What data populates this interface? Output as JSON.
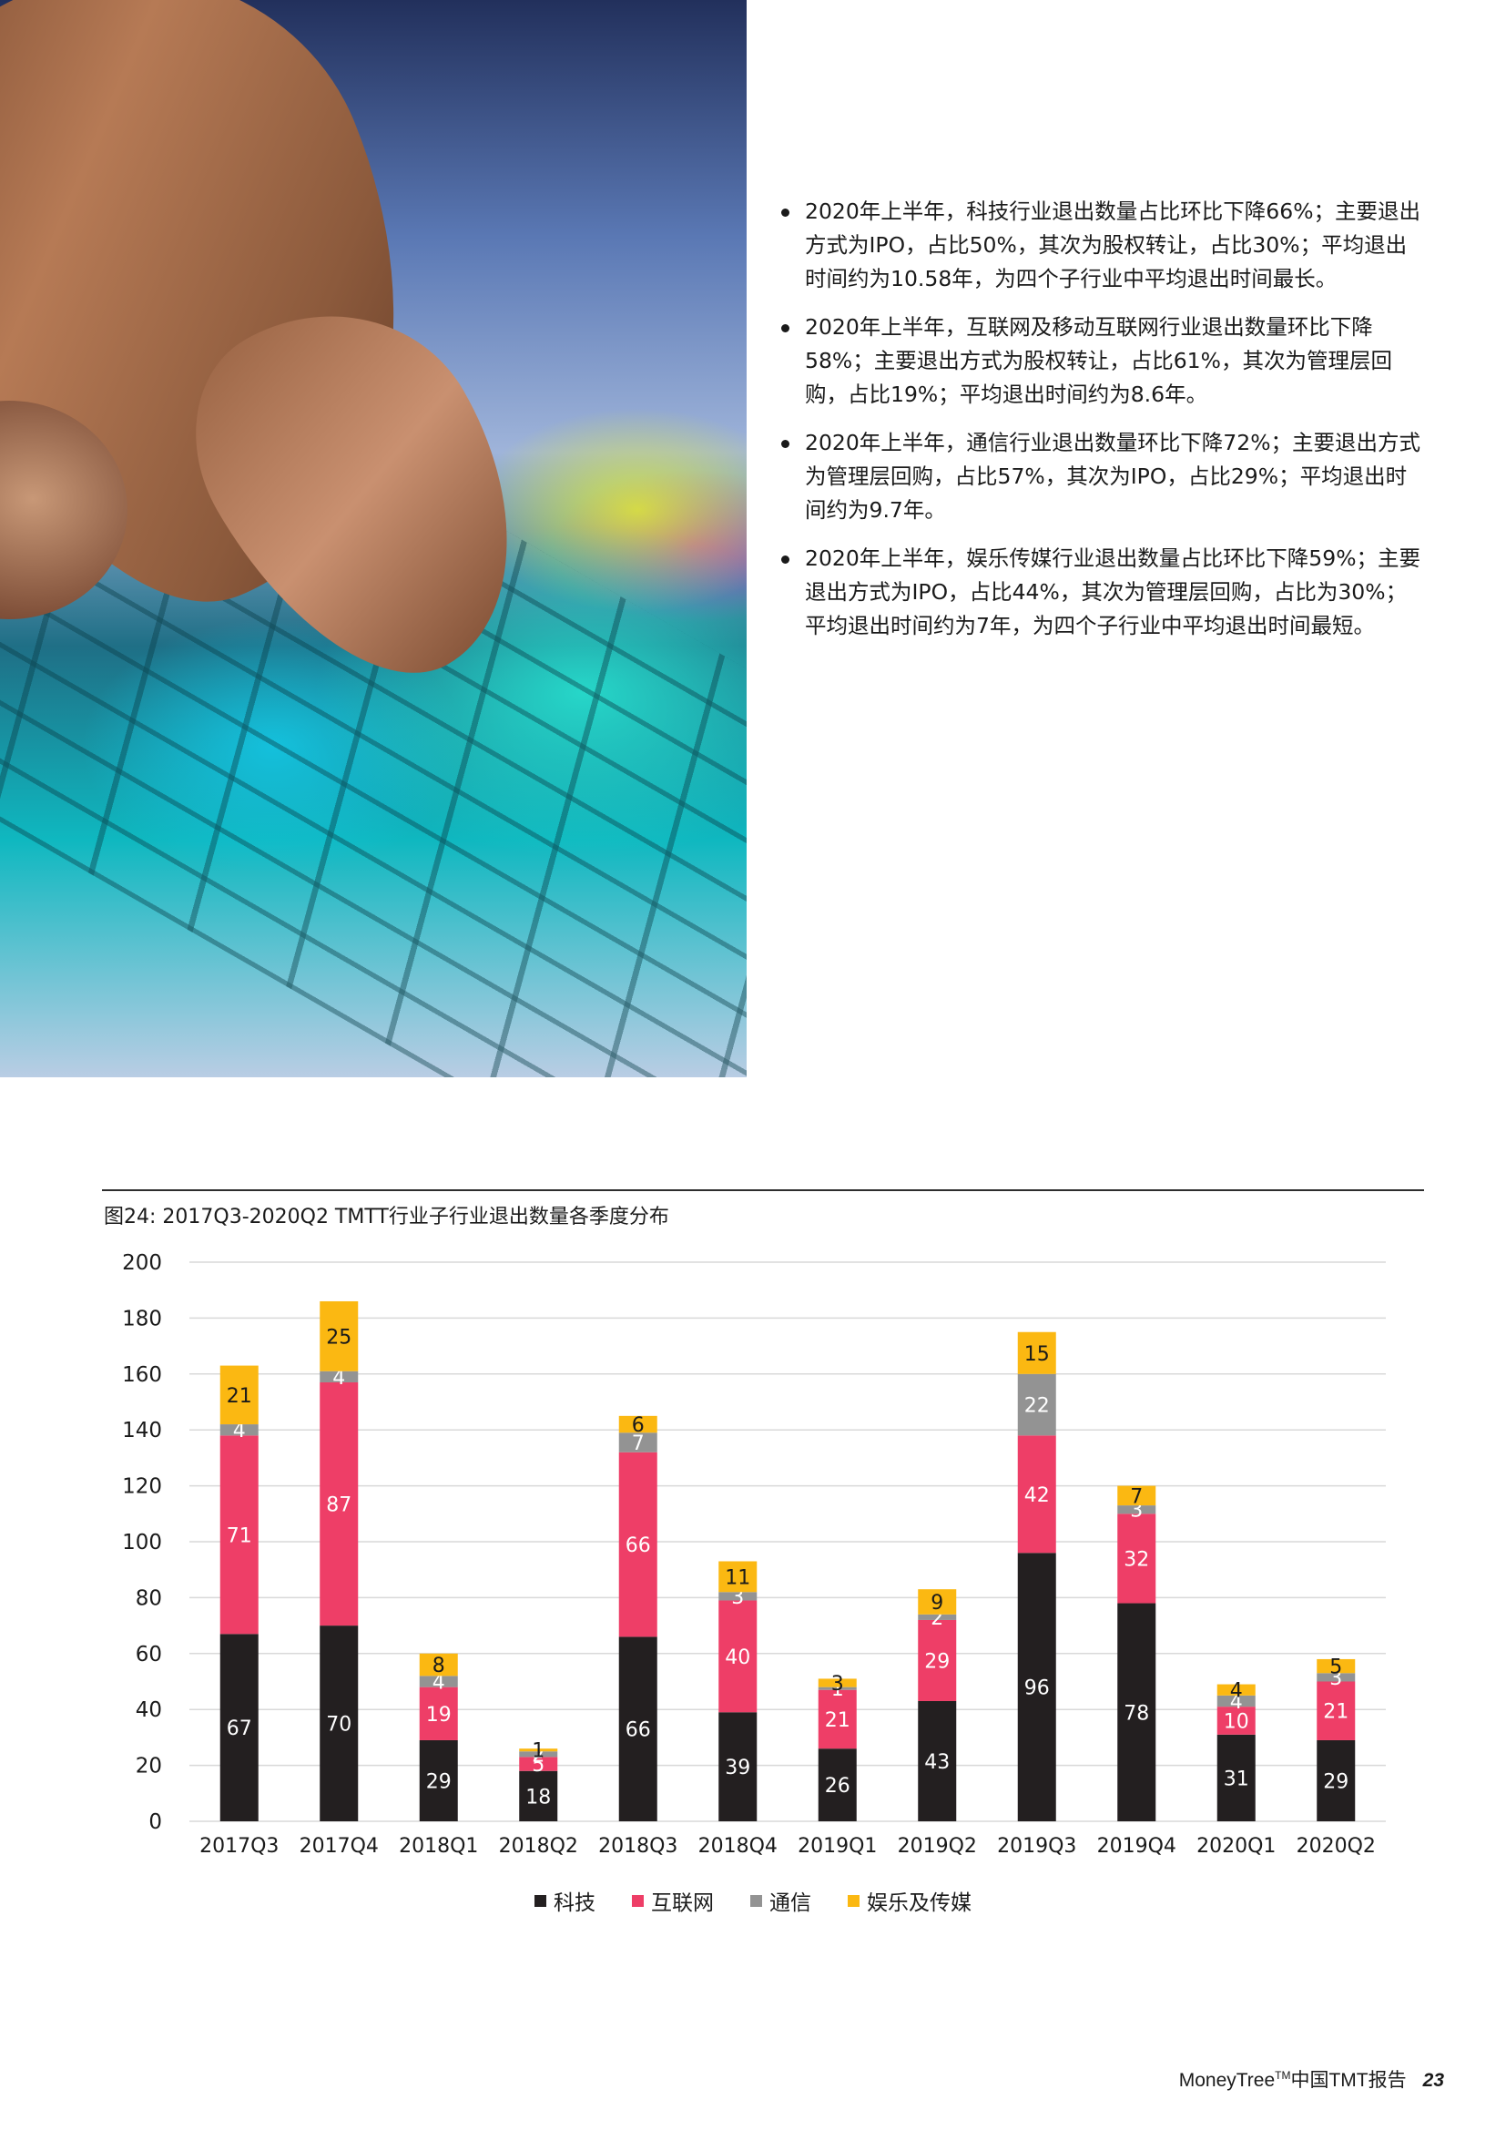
{
  "bullets": [
    "2020年上半年，科技行业退出数量占比环比下降66%；主要退出方式为IPO，占比50%，其次为股权转让，占比30%；平均退出时间约为10.58年，为四个子行业中平均退出时间最长。",
    "2020年上半年，互联网及移动互联网行业退出数量环比下降58%；主要退出方式为股权转让，占比61%，其次为管理层回购，占比19%；平均退出时间约为8.6年。",
    "2020年上半年，通信行业退出数量环比下降72%；主要退出方式为管理层回购，占比57%，其次为IPO，占比29%；平均退出时间约为9.7年。",
    "2020年上半年，娱乐传媒行业退出数量占比环比下降59%；主要退出方式为IPO，占比44%，其次为管理层回购，占比为30%；平均退出时间约为7年，为四个子行业中平均退出时间最短。"
  ],
  "chart_title": "图24: 2017Q3-2020Q2 TMTT行业子行业退出数量各季度分布",
  "chart_data": {
    "type": "bar",
    "stacked": true,
    "title": "图24: 2017Q3-2020Q2 TMTT行业子行业退出数量各季度分布",
    "categories": [
      "2017Q3",
      "2017Q4",
      "2018Q1",
      "2018Q2",
      "2018Q3",
      "2018Q4",
      "2019Q1",
      "2019Q2",
      "2019Q3",
      "2019Q4",
      "2020Q1",
      "2020Q2"
    ],
    "series": [
      {
        "name": "科技",
        "color": "#231f20",
        "values": [
          67,
          70,
          29,
          18,
          66,
          39,
          26,
          43,
          96,
          78,
          31,
          29
        ]
      },
      {
        "name": "互联网",
        "color": "#ee3e67",
        "values": [
          71,
          87,
          19,
          5,
          66,
          40,
          21,
          29,
          42,
          32,
          10,
          21
        ]
      },
      {
        "name": "通信",
        "color": "#939393",
        "values": [
          4,
          4,
          4,
          2,
          7,
          3,
          1,
          2,
          22,
          3,
          4,
          3
        ]
      },
      {
        "name": "娱乐及传媒",
        "color": "#fbb812",
        "values": [
          21,
          25,
          8,
          1,
          6,
          11,
          3,
          9,
          15,
          7,
          4,
          5
        ]
      }
    ],
    "ylim": [
      0,
      200
    ],
    "yticks": [
      0,
      20,
      40,
      60,
      80,
      100,
      120,
      140,
      160,
      180,
      200
    ],
    "grid": true,
    "legend": "bottom",
    "xlabel": "",
    "ylabel": ""
  },
  "footer": {
    "brand": "MoneyTree",
    "tm": "TM",
    "report": "中国TMT报告",
    "page": "23"
  }
}
